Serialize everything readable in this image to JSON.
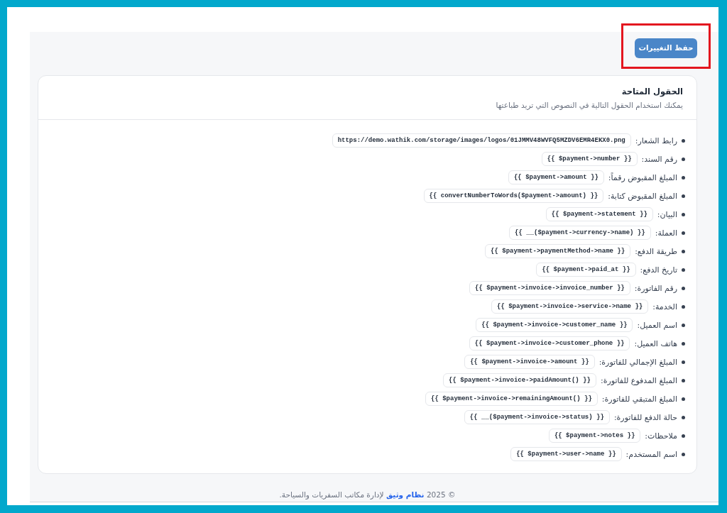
{
  "save_button": {
    "label": "حفظ التغييرات",
    "highlighted": true
  },
  "fields_card": {
    "title": "الحقول المتاحة",
    "subtitle": "يمكنك استخدام الحقول التالية في النصوص التي تريد طباعتها",
    "fields": [
      {
        "label": "رابط الشعار:",
        "value": "https://demo.wathik.com/storage/images/logos/01JMMV48WVFQ5MZDV6EMR4EKX0.png"
      },
      {
        "label": "رقم السند:",
        "value": "{{ $payment->number }}"
      },
      {
        "label": "المبلغ المقبوض رقماً:",
        "value": "{{ $payment->amount }}"
      },
      {
        "label": "المبلغ المقبوض كتابة:",
        "value": "{{ convertNumberToWords($payment->amount) }}"
      },
      {
        "label": "البيان:",
        "value": "{{ $payment->statement }}"
      },
      {
        "label": "العملة:",
        "value": "{{ __($payment->currency->name) }}"
      },
      {
        "label": "طريقة الدفع:",
        "value": "{{ $payment->paymentMethod->name }}"
      },
      {
        "label": "تاريخ الدفع:",
        "value": "{{ $payment->paid_at }}"
      },
      {
        "label": "رقم الفاتورة:",
        "value": "{{ $payment->invoice->invoice_number }}"
      },
      {
        "label": "الخدمة:",
        "value": "{{ $payment->invoice->service->name }}"
      },
      {
        "label": "اسم العميل:",
        "value": "{{ $payment->invoice->customer_name }}"
      },
      {
        "label": "هاتف العميل:",
        "value": "{{ $payment->invoice->customer_phone }}"
      },
      {
        "label": "المبلغ الإجمالي للفاتورة:",
        "value": "{{ $payment->invoice->amount }}"
      },
      {
        "label": "المبلغ المدفوع للفاتورة:",
        "value": "{{ $payment->invoice->paidAmount() }}"
      },
      {
        "label": "المبلغ المتبقي للفاتورة:",
        "value": "{{ $payment->invoice->remainingAmount() }}"
      },
      {
        "label": "حالة الدفع للفاتورة:",
        "value": "{{ __($payment->invoice->status) }}"
      },
      {
        "label": "ملاحظات:",
        "value": "{{ $payment->notes }}"
      },
      {
        "label": "اسم المستخدم:",
        "value": "{{ $payment->user->name }}"
      }
    ]
  },
  "footer": {
    "prefix": "© 2025",
    "brand": "نظام وثيق",
    "suffix": "لإدارة مكاتب السفريات والسياحة."
  }
}
